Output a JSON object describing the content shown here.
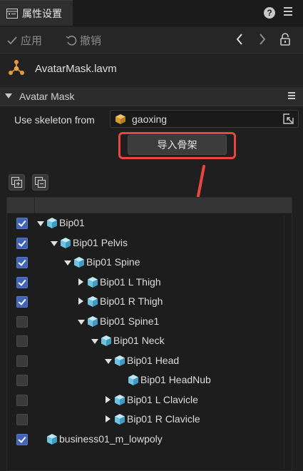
{
  "tab": {
    "title": "属性设置",
    "icon": "inspector-icon"
  },
  "toolbar": {
    "apply_label": "应用",
    "revert_label": "撤销"
  },
  "file": {
    "name": "AvatarMask.lavm",
    "icon": "molecule-icon"
  },
  "section": {
    "title": "Avatar Mask"
  },
  "skeleton": {
    "label": "Use skeleton from",
    "value": "gaoxing"
  },
  "import_button": {
    "label": "导入骨架"
  },
  "highlight_color": "#e8473d",
  "tree": {
    "rows": [
      {
        "label": "Bip01",
        "checked": true,
        "depth": 0,
        "expander": "down"
      },
      {
        "label": "Bip01 Pelvis",
        "checked": true,
        "depth": 1,
        "expander": "down"
      },
      {
        "label": "Bip01 Spine",
        "checked": true,
        "depth": 2,
        "expander": "down"
      },
      {
        "label": "Bip01 L Thigh",
        "checked": true,
        "depth": 3,
        "expander": "right"
      },
      {
        "label": "Bip01 R Thigh",
        "checked": true,
        "depth": 3,
        "expander": "right"
      },
      {
        "label": "Bip01 Spine1",
        "checked": false,
        "depth": 3,
        "expander": "down"
      },
      {
        "label": "Bip01 Neck",
        "checked": false,
        "depth": 4,
        "expander": "down"
      },
      {
        "label": "Bip01 Head",
        "checked": false,
        "depth": 5,
        "expander": "down"
      },
      {
        "label": "Bip01 HeadNub",
        "checked": false,
        "depth": 6,
        "expander": "none"
      },
      {
        "label": "Bip01 L Clavicle",
        "checked": false,
        "depth": 5,
        "expander": "right"
      },
      {
        "label": "Bip01 R Clavicle",
        "checked": false,
        "depth": 5,
        "expander": "right"
      },
      {
        "label": "business01_m_lowpoly",
        "checked": true,
        "depth": 0,
        "expander": "none"
      }
    ]
  }
}
